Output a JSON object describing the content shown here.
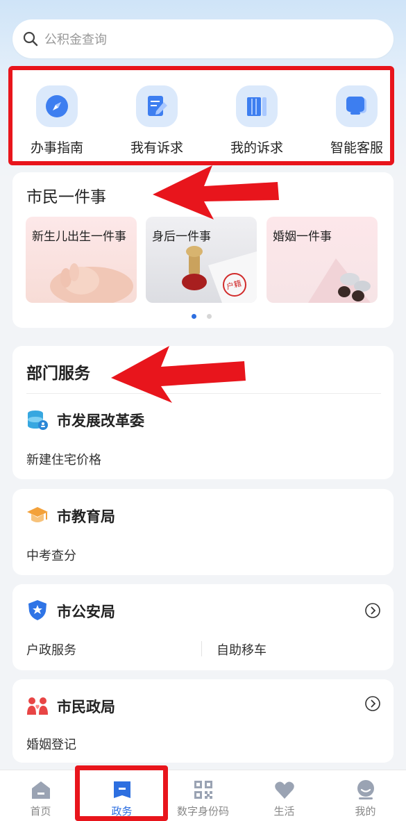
{
  "search": {
    "placeholder": "公积金查询"
  },
  "quick_actions": [
    {
      "label": "办事指南",
      "icon": "compass-icon"
    },
    {
      "label": "我有诉求",
      "icon": "edit-icon"
    },
    {
      "label": "我的诉求",
      "icon": "book-icon"
    },
    {
      "label": "智能客服",
      "icon": "chat-icon"
    }
  ],
  "citizen_matters": {
    "title": "市民一件事",
    "tiles": [
      {
        "label": "新生儿出生一件事"
      },
      {
        "label": "身后一件事"
      },
      {
        "label": "婚姻一件事"
      }
    ],
    "tile_stamp_text": "户籍",
    "page_dots": {
      "count": 2,
      "active": 0
    }
  },
  "department_services": {
    "title": "部门服务",
    "departments": [
      {
        "name": "市发展改革委",
        "icon": "database-icon",
        "services": [
          "新建住宅价格"
        ],
        "has_arrow": false
      },
      {
        "name": "市教育局",
        "icon": "graduation-cap-icon",
        "services": [
          "中考查分"
        ],
        "has_arrow": false
      },
      {
        "name": "市公安局",
        "icon": "police-shield-icon",
        "services": [
          "户政服务",
          "自助移车"
        ],
        "has_arrow": true
      },
      {
        "name": "市民政局",
        "icon": "people-heart-icon",
        "services": [
          "婚姻登记"
        ],
        "has_arrow": true
      }
    ]
  },
  "tabbar": {
    "items": [
      {
        "label": "首页",
        "icon": "home-icon",
        "active": false
      },
      {
        "label": "政务",
        "icon": "government-icon",
        "active": true
      },
      {
        "label": "数字身份码",
        "icon": "qr-code-icon",
        "active": false
      },
      {
        "label": "生活",
        "icon": "heart-icon",
        "active": false
      },
      {
        "label": "我的",
        "icon": "profile-icon",
        "active": false
      }
    ]
  },
  "colors": {
    "accent": "#2d6fe0",
    "annotation_red": "#e8151c",
    "icon_bg": "#dbe9fb"
  }
}
